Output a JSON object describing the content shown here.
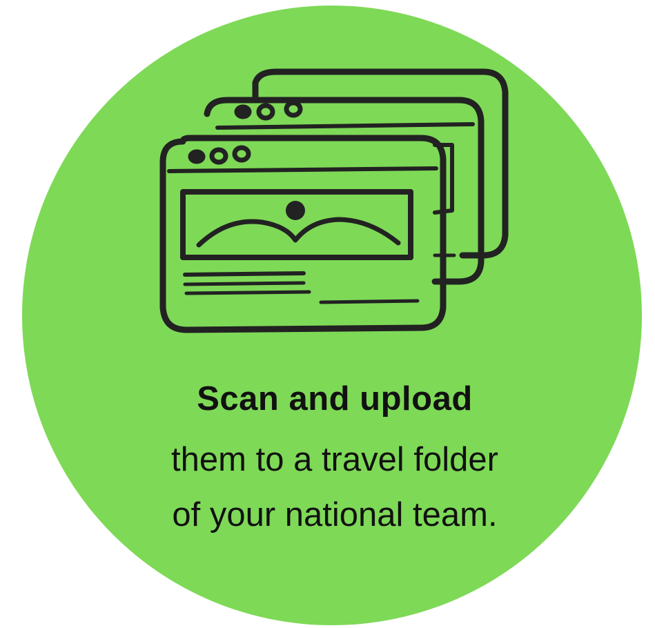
{
  "graphic": {
    "background_color": "#7ed957",
    "ink_color": "#222222",
    "icon": "stacked-browser-windows-icon"
  },
  "text": {
    "headline": "Scan and upload",
    "line2": "them to  a travel folder",
    "line3": "of your national team."
  }
}
